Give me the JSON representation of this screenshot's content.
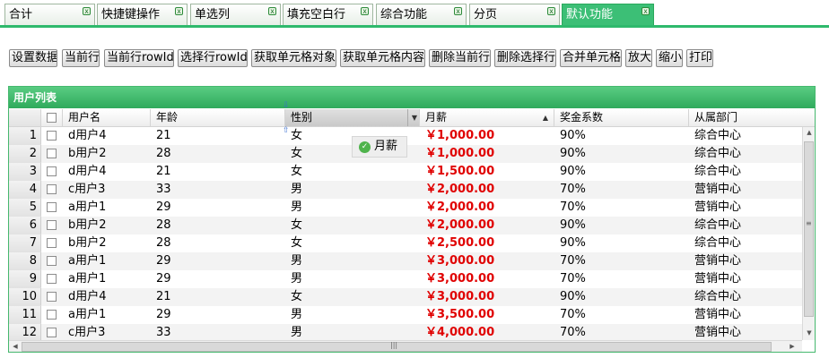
{
  "tabs": [
    {
      "label": "合计",
      "active": false
    },
    {
      "label": "快捷键操作",
      "active": false
    },
    {
      "label": "单选列",
      "active": false
    },
    {
      "label": "填充空白行",
      "active": false
    },
    {
      "label": "综合功能",
      "active": false
    },
    {
      "label": "分页",
      "active": false
    },
    {
      "label": "默认功能",
      "active": true
    }
  ],
  "toolbar": [
    "设置数据",
    "当前行",
    "当前行rowId",
    "选择行rowId",
    "获取单元格对象",
    "获取单元格内容",
    "删除当前行",
    "删除选择行",
    "合并单元格",
    "放大",
    "缩小",
    "打印"
  ],
  "grid": {
    "title": "用户列表",
    "columns": [
      "用户名",
      "年龄",
      "性别",
      "月薪",
      "奖金系数",
      "从属部门"
    ],
    "sort_column": "月薪",
    "sort_direction": "asc",
    "rows": [
      {
        "num": "1",
        "name": "d用户4",
        "age": "21",
        "gender": "女",
        "salary": "￥1,000.00",
        "bonus": "90%",
        "dept": "综合中心"
      },
      {
        "num": "2",
        "name": "b用户2",
        "age": "28",
        "gender": "女",
        "salary": "￥1,000.00",
        "bonus": "90%",
        "dept": "综合中心"
      },
      {
        "num": "3",
        "name": "d用户4",
        "age": "21",
        "gender": "女",
        "salary": "￥1,500.00",
        "bonus": "90%",
        "dept": "综合中心"
      },
      {
        "num": "4",
        "name": "c用户3",
        "age": "33",
        "gender": "男",
        "salary": "￥2,000.00",
        "bonus": "70%",
        "dept": "营销中心"
      },
      {
        "num": "5",
        "name": "a用户1",
        "age": "29",
        "gender": "男",
        "salary": "￥2,000.00",
        "bonus": "70%",
        "dept": "营销中心"
      },
      {
        "num": "6",
        "name": "b用户2",
        "age": "28",
        "gender": "女",
        "salary": "￥2,000.00",
        "bonus": "90%",
        "dept": "综合中心"
      },
      {
        "num": "7",
        "name": "b用户2",
        "age": "28",
        "gender": "女",
        "salary": "￥2,500.00",
        "bonus": "90%",
        "dept": "综合中心"
      },
      {
        "num": "8",
        "name": "a用户1",
        "age": "29",
        "gender": "男",
        "salary": "￥3,000.00",
        "bonus": "70%",
        "dept": "营销中心"
      },
      {
        "num": "9",
        "name": "a用户1",
        "age": "29",
        "gender": "男",
        "salary": "￥3,000.00",
        "bonus": "70%",
        "dept": "营销中心"
      },
      {
        "num": "10",
        "name": "d用户4",
        "age": "21",
        "gender": "女",
        "salary": "￥3,000.00",
        "bonus": "90%",
        "dept": "综合中心"
      },
      {
        "num": "11",
        "name": "a用户1",
        "age": "29",
        "gender": "男",
        "salary": "￥3,500.00",
        "bonus": "70%",
        "dept": "营销中心"
      },
      {
        "num": "12",
        "name": "c用户3",
        "age": "33",
        "gender": "男",
        "salary": "￥4,000.00",
        "bonus": "70%",
        "dept": "营销中心"
      }
    ]
  },
  "drag_tooltip": {
    "label": "月薪"
  },
  "colors": {
    "accent": "#3cbf76",
    "money": "#e00000"
  }
}
